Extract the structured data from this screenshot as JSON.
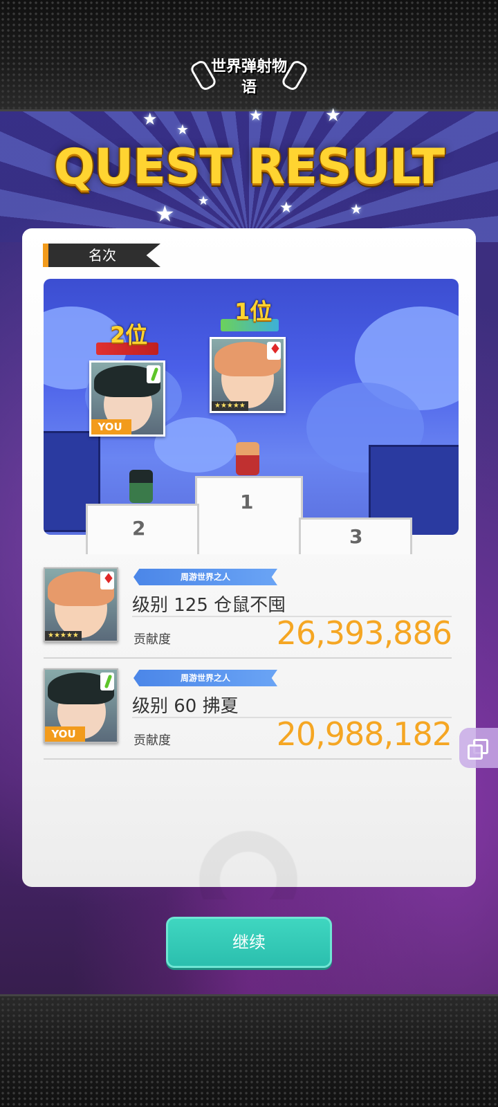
{
  "app": {
    "logo_text": "世界弹射物语"
  },
  "header": {
    "title": "QUEST RESULT"
  },
  "section": {
    "label": "名次"
  },
  "podium": {
    "first_label": "1位",
    "second_label": "2位",
    "step_1": "1",
    "step_2": "2",
    "step_3": "3",
    "you_tag": "YOU",
    "rarity_stars": "★★★★★"
  },
  "results": [
    {
      "title_banner": "周游世界之人",
      "name": "级别 125 仓鼠不囤",
      "contrib_label": "贡献度",
      "contrib_value": "26,393,886",
      "rarity_stars": "★★★★★",
      "attribute_icon": "diamond-icon"
    },
    {
      "title_banner": "周游世界之人",
      "name": "级别 60 拂夏",
      "contrib_label": "贡献度",
      "contrib_value": "20,988,182",
      "you_tag": "YOU",
      "attribute_icon": "leaf-icon"
    }
  ],
  "footer": {
    "continue_label": "继续"
  },
  "colors": {
    "accent_gold": "#ffd431",
    "contrib_orange": "#f5a623",
    "button_teal": "#2bbfae",
    "banner_blue": "#4b86e8"
  }
}
